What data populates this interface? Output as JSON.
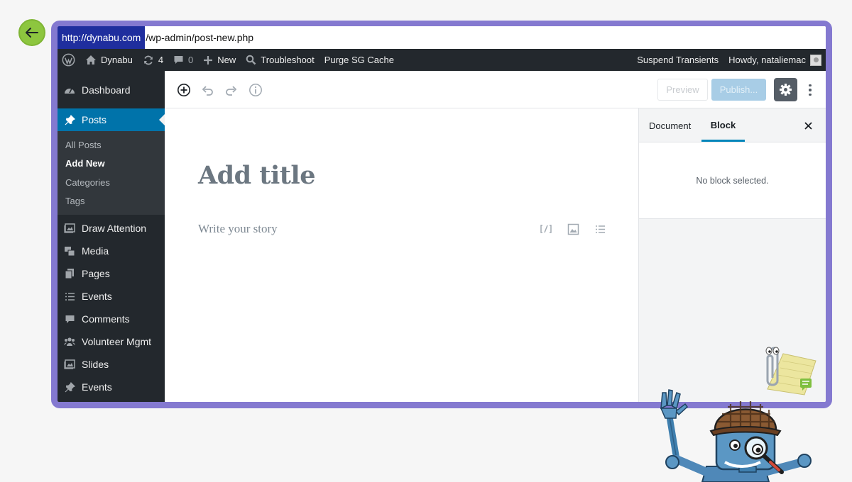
{
  "browser": {
    "url_host": "http://dynabu.com",
    "url_path": "/wp-admin/post-new.php"
  },
  "admin_bar": {
    "site_name": "Dynabu",
    "updates_count": "4",
    "comments_count": "0",
    "new_label": "New",
    "troubleshoot_label": "Troubleshoot",
    "purge_label": "Purge SG Cache",
    "suspend_label": "Suspend Transients",
    "howdy_label": "Howdy, nataliemac"
  },
  "sidebar": {
    "dashboard": "Dashboard",
    "posts": "Posts",
    "posts_submenu": [
      "All Posts",
      "Add New",
      "Categories",
      "Tags"
    ],
    "items": [
      "Draw Attention",
      "Media",
      "Pages",
      "Events",
      "Comments",
      "Volunteer Mgmt",
      "Slides",
      "Events"
    ]
  },
  "toolbar": {
    "preview_label": "Preview",
    "publish_label": "Publish..."
  },
  "editor": {
    "title_placeholder": "Add title",
    "story_placeholder": "Write your story",
    "inline_icons": [
      "shortcode-icon",
      "image-icon",
      "list-icon"
    ]
  },
  "panel": {
    "tab_document": "Document",
    "tab_block": "Block",
    "empty_message": "No block selected."
  },
  "colors": {
    "frame": "#8479d0",
    "admin_bar": "#23282d",
    "accent": "#0073aa",
    "back_button": "#8dc63f"
  }
}
